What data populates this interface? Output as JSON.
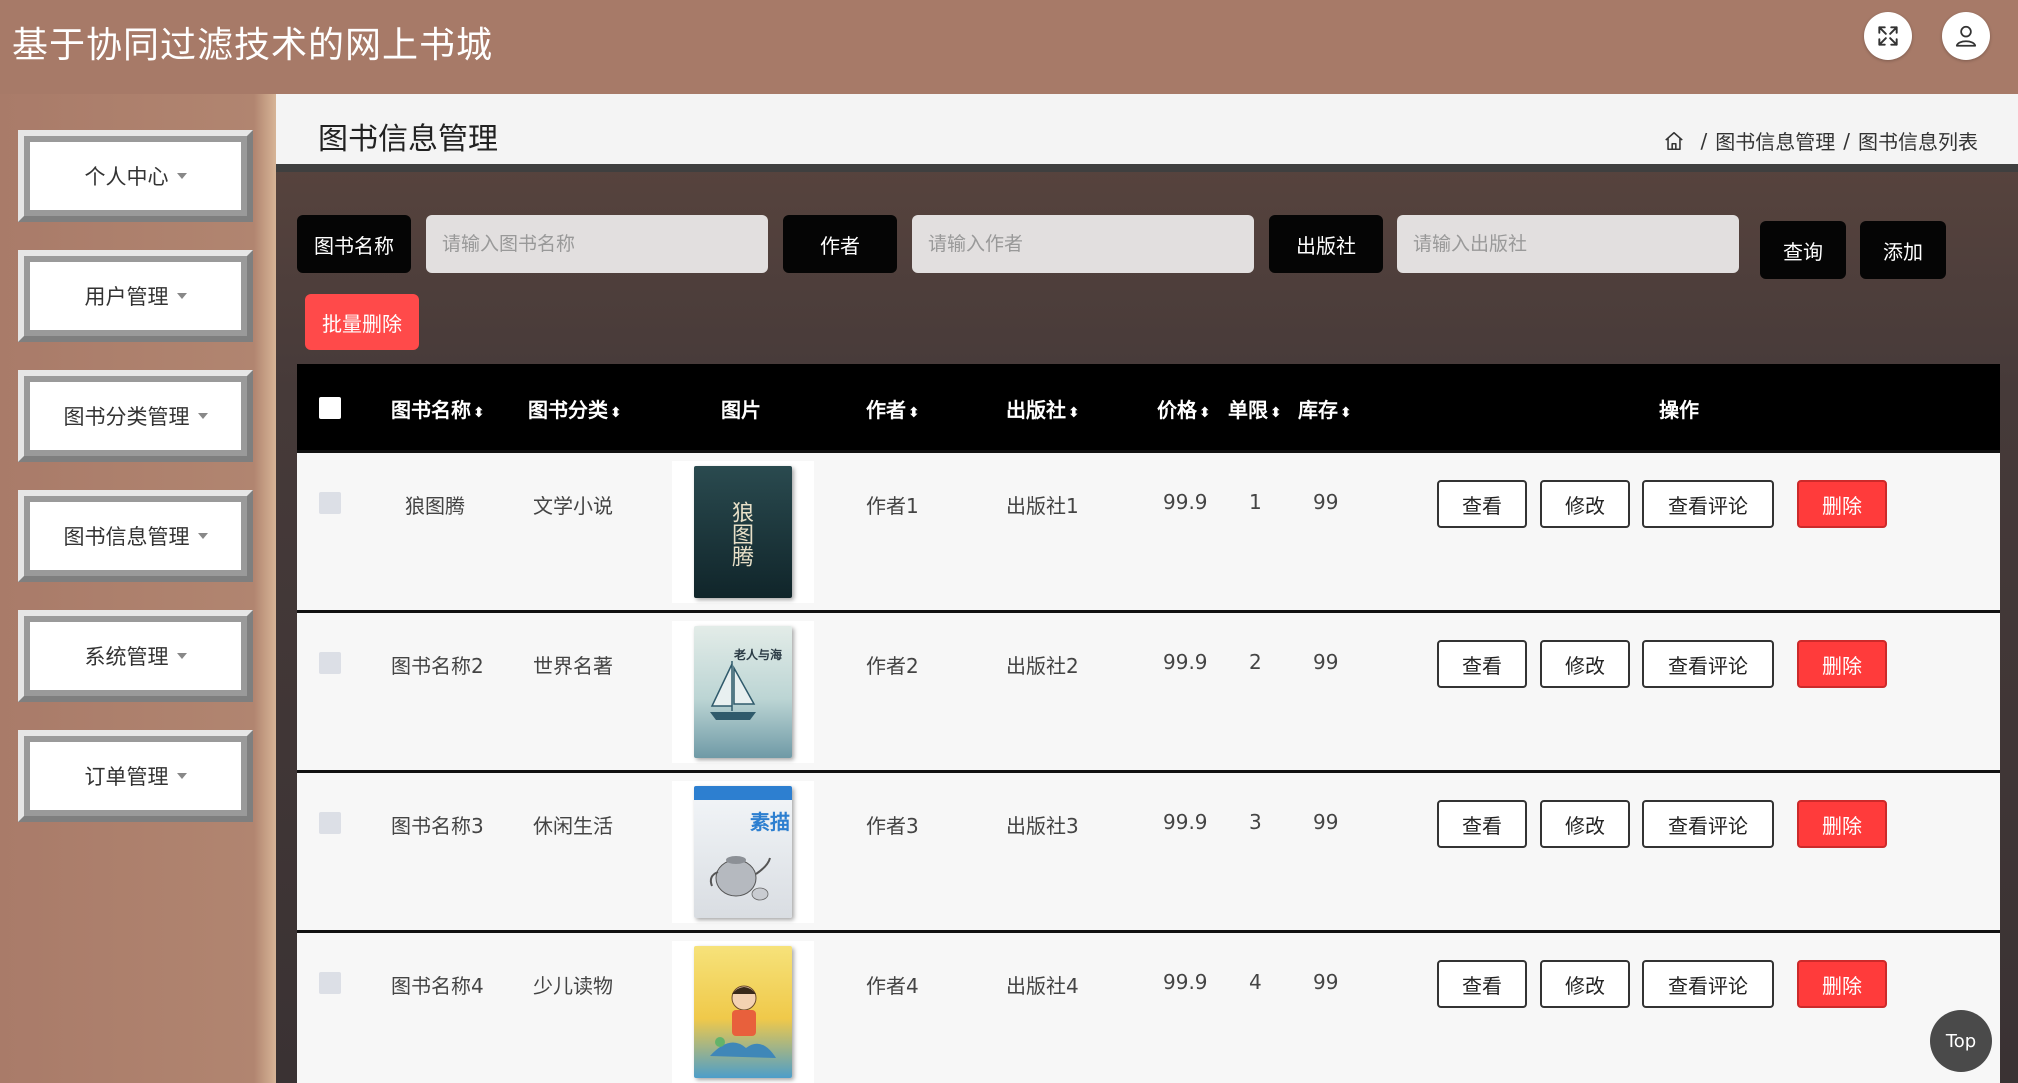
{
  "app": {
    "title": "基于协同过滤技术的网上书城",
    "fullscreen_icon": "expand-icon",
    "user_icon": "user-icon"
  },
  "sidebar": {
    "items": [
      {
        "label": "个人中心"
      },
      {
        "label": "用户管理"
      },
      {
        "label": "图书分类管理"
      },
      {
        "label": "图书信息管理"
      },
      {
        "label": "系统管理"
      },
      {
        "label": "订单管理"
      }
    ]
  },
  "page": {
    "title": "图书信息管理",
    "breadcrumb": [
      "图书信息管理",
      "图书信息列表"
    ],
    "breadcrumb_sep": "/"
  },
  "search": {
    "name_label": "图书名称",
    "name_placeholder": "请输入图书名称",
    "author_label": "作者",
    "author_placeholder": "请输入作者",
    "publisher_label": "出版社",
    "publisher_placeholder": "请输入出版社",
    "query_button": "查询",
    "add_button": "添加",
    "batch_delete_button": "批量删除"
  },
  "table": {
    "headers": {
      "name": "图书名称",
      "category": "图书分类",
      "image": "图片",
      "author": "作者",
      "publisher": "出版社",
      "price": "价格",
      "limit": "单限",
      "stock": "库存",
      "actions": "操作"
    },
    "sort_icon": "⬍",
    "rows": [
      {
        "name": "狼图腾",
        "category": "文学小说",
        "author": "作者1",
        "publisher": "出版社1",
        "price": "99.9",
        "limit": "1",
        "stock": "99",
        "cover_color": "#1f3a3f"
      },
      {
        "name": "图书名称2",
        "category": "世界名著",
        "author": "作者2",
        "publisher": "出版社2",
        "price": "99.9",
        "limit": "2",
        "stock": "99",
        "cover_color": "#cfe0dc"
      },
      {
        "name": "图书名称3",
        "category": "休闲生活",
        "author": "作者3",
        "publisher": "出版社3",
        "price": "99.9",
        "limit": "3",
        "stock": "99",
        "cover_color": "#e9eef3"
      },
      {
        "name": "图书名称4",
        "category": "少儿读物",
        "author": "作者4",
        "publisher": "出版社4",
        "price": "99.9",
        "limit": "4",
        "stock": "99",
        "cover_color": "#f2d55a"
      }
    ],
    "actions": {
      "view": "查看",
      "edit": "修改",
      "comments": "查看评论",
      "delete": "删除"
    }
  },
  "cover_text": {
    "row1": "狼图腾",
    "row2": "老人与海",
    "row3": "素描"
  },
  "top_button": "Top",
  "colors": {
    "header_bg": "#a77a68",
    "delete_red": "#ff3b3b",
    "dark": "#050505"
  }
}
